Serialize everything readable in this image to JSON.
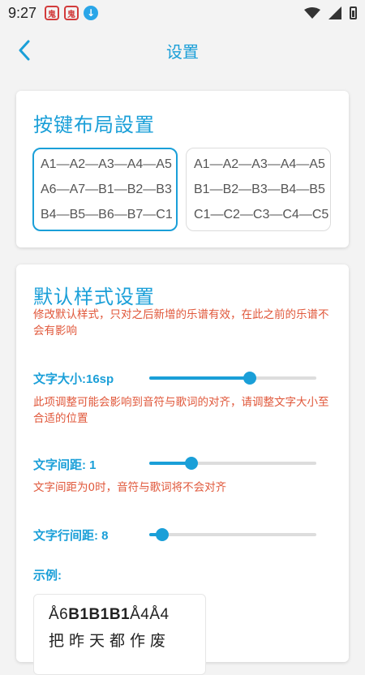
{
  "status_bar": {
    "time": "9:27",
    "notifications": [
      {
        "icon": "app-notification-icon",
        "glyph": "鬼"
      },
      {
        "icon": "app-notification-icon",
        "glyph": "鬼"
      },
      {
        "icon": "download-icon",
        "glyph": "↓"
      }
    ],
    "right_icons": [
      "wifi-icon",
      "signal-icon",
      "battery-icon"
    ]
  },
  "header": {
    "title": "设置",
    "back_icon": "chevron-left-icon"
  },
  "key_layout": {
    "heading": "按键布局設置",
    "options": [
      {
        "selected": true,
        "lines": [
          "A1—A2—A3—A4—A5",
          "A6—A7—B1—B2—B3",
          "B4—B5—B6—B7—C1"
        ]
      },
      {
        "selected": false,
        "lines": [
          "A1—A2—A3—A4—A5",
          "B1—B2—B3—B4—B5",
          "C1—C2—C3—C4—C5"
        ]
      }
    ]
  },
  "default_style": {
    "heading": "默认样式设置",
    "note": "修改默认样式，只对之后新增的乐谱有效，在此之前的乐谱不会有影响",
    "font_size": {
      "label": "文字大小:16sp",
      "value_fraction": 0.6,
      "hint": "此项调整可能会影响到音符与歌词的对齐，请调整文字大小至合适的位置"
    },
    "letter_spacing": {
      "label": "文字间距: 1",
      "value_fraction": 0.25,
      "hint": "文字间距为0时，音符与歌词将不会对齐"
    },
    "line_spacing": {
      "label": "文字行间距: 8",
      "value_fraction": 0.08
    },
    "example": {
      "label": "示例:",
      "line1_parts": [
        {
          "text": "Å6",
          "bold": false
        },
        {
          "text": "B1B1B1",
          "bold": true
        },
        {
          "text": "Å4Å4",
          "bold": false
        }
      ],
      "line2": "把昨天都作废"
    }
  },
  "colors": {
    "accent": "#1a9fd8",
    "warning": "#e0573a",
    "background": "#f3f3f3"
  }
}
